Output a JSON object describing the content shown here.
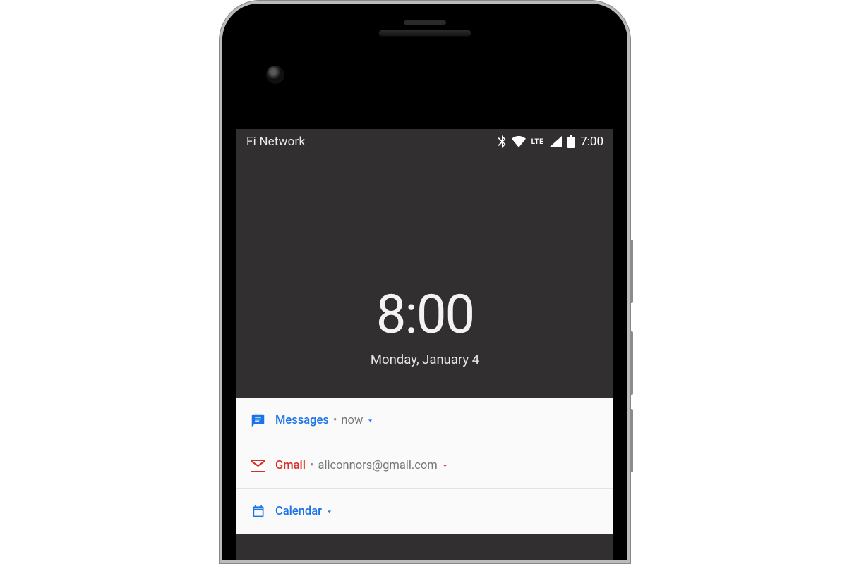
{
  "status": {
    "network": "Fi Network",
    "lte": "LTE",
    "time": "7:00"
  },
  "lock": {
    "time": "8:00",
    "date": "Monday, January 4"
  },
  "cards": {
    "messages": {
      "app": "Messages",
      "meta": "now"
    },
    "gmail": {
      "app": "Gmail",
      "meta": "aliconnors@gmail.com"
    },
    "calendar": {
      "app": "Calendar"
    }
  },
  "colors": {
    "blue": "#1a73e8",
    "red": "#d93025"
  }
}
